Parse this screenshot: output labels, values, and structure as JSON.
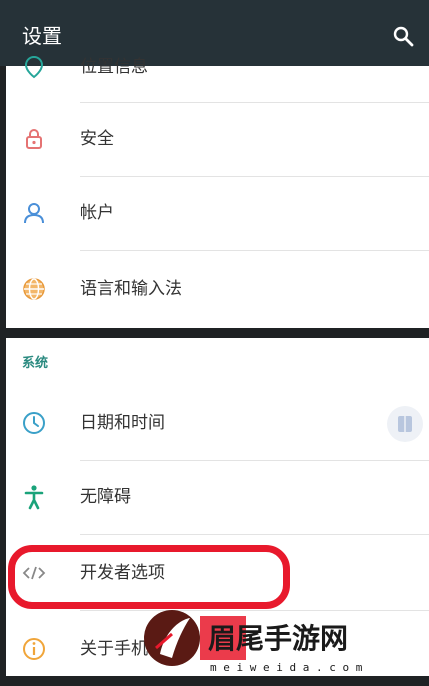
{
  "header": {
    "title": "设置"
  },
  "top_items": [
    {
      "label": "位置信息"
    },
    {
      "label": "安全"
    },
    {
      "label": "帐户"
    },
    {
      "label": "语言和输入法"
    }
  ],
  "system_section": {
    "header": "系统",
    "items": [
      {
        "label": "日期和时间"
      },
      {
        "label": "无障碍"
      },
      {
        "label": "开发者选项"
      },
      {
        "label": "关于手机"
      }
    ]
  },
  "watermark": {
    "title": "眉尾手游网",
    "domain": "m e i w e i d a . c o m"
  },
  "colors": {
    "accent": "#2b8a80",
    "highlight": "#e8192c",
    "toolbar": "#263238"
  }
}
